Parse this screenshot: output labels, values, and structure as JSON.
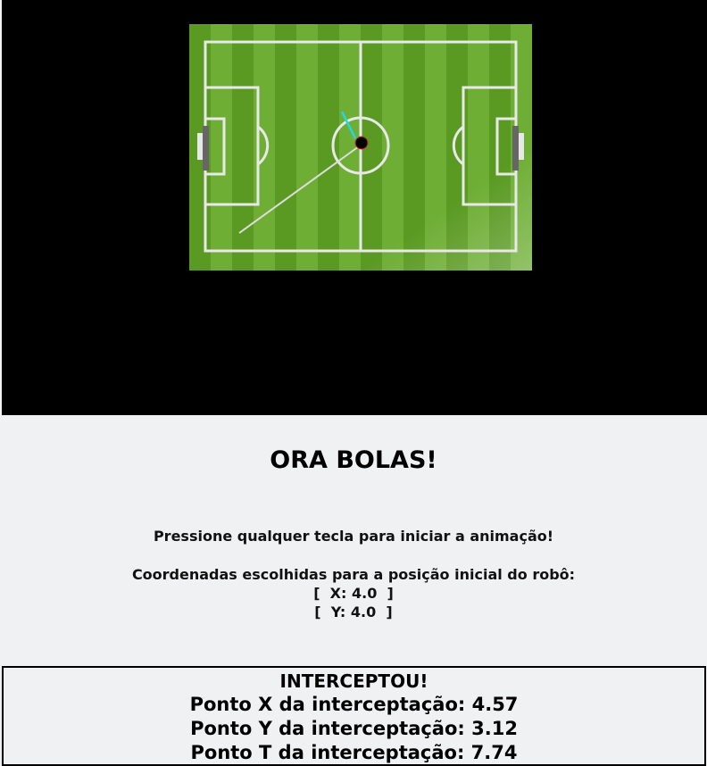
{
  "game": {
    "field": {
      "grass_colors": [
        "#5a9a22",
        "#6fae35"
      ],
      "line_color": "#e8e8e8",
      "goal_color": "#666666"
    },
    "ball_color": "#000000",
    "robot_velocity_color": "#20d8e8",
    "trajectory_color": "#dddddd"
  },
  "title": "ORA BOLAS!",
  "instructions": {
    "press_key": "Pressione qualquer tecla para iniciar a animação!",
    "coords_heading": "Coordenadas escolhidas para a posição inicial do robô:",
    "coord_x": "[  X: 4.0  ]",
    "coord_y": "[  Y: 4.0  ]"
  },
  "result": {
    "status": "INTERCEPTOU!",
    "point_x": "Ponto X da interceptação: 4.57",
    "point_y": "Ponto Y da interceptação: 3.12",
    "point_t": "Ponto T da interceptação: 7.74"
  }
}
